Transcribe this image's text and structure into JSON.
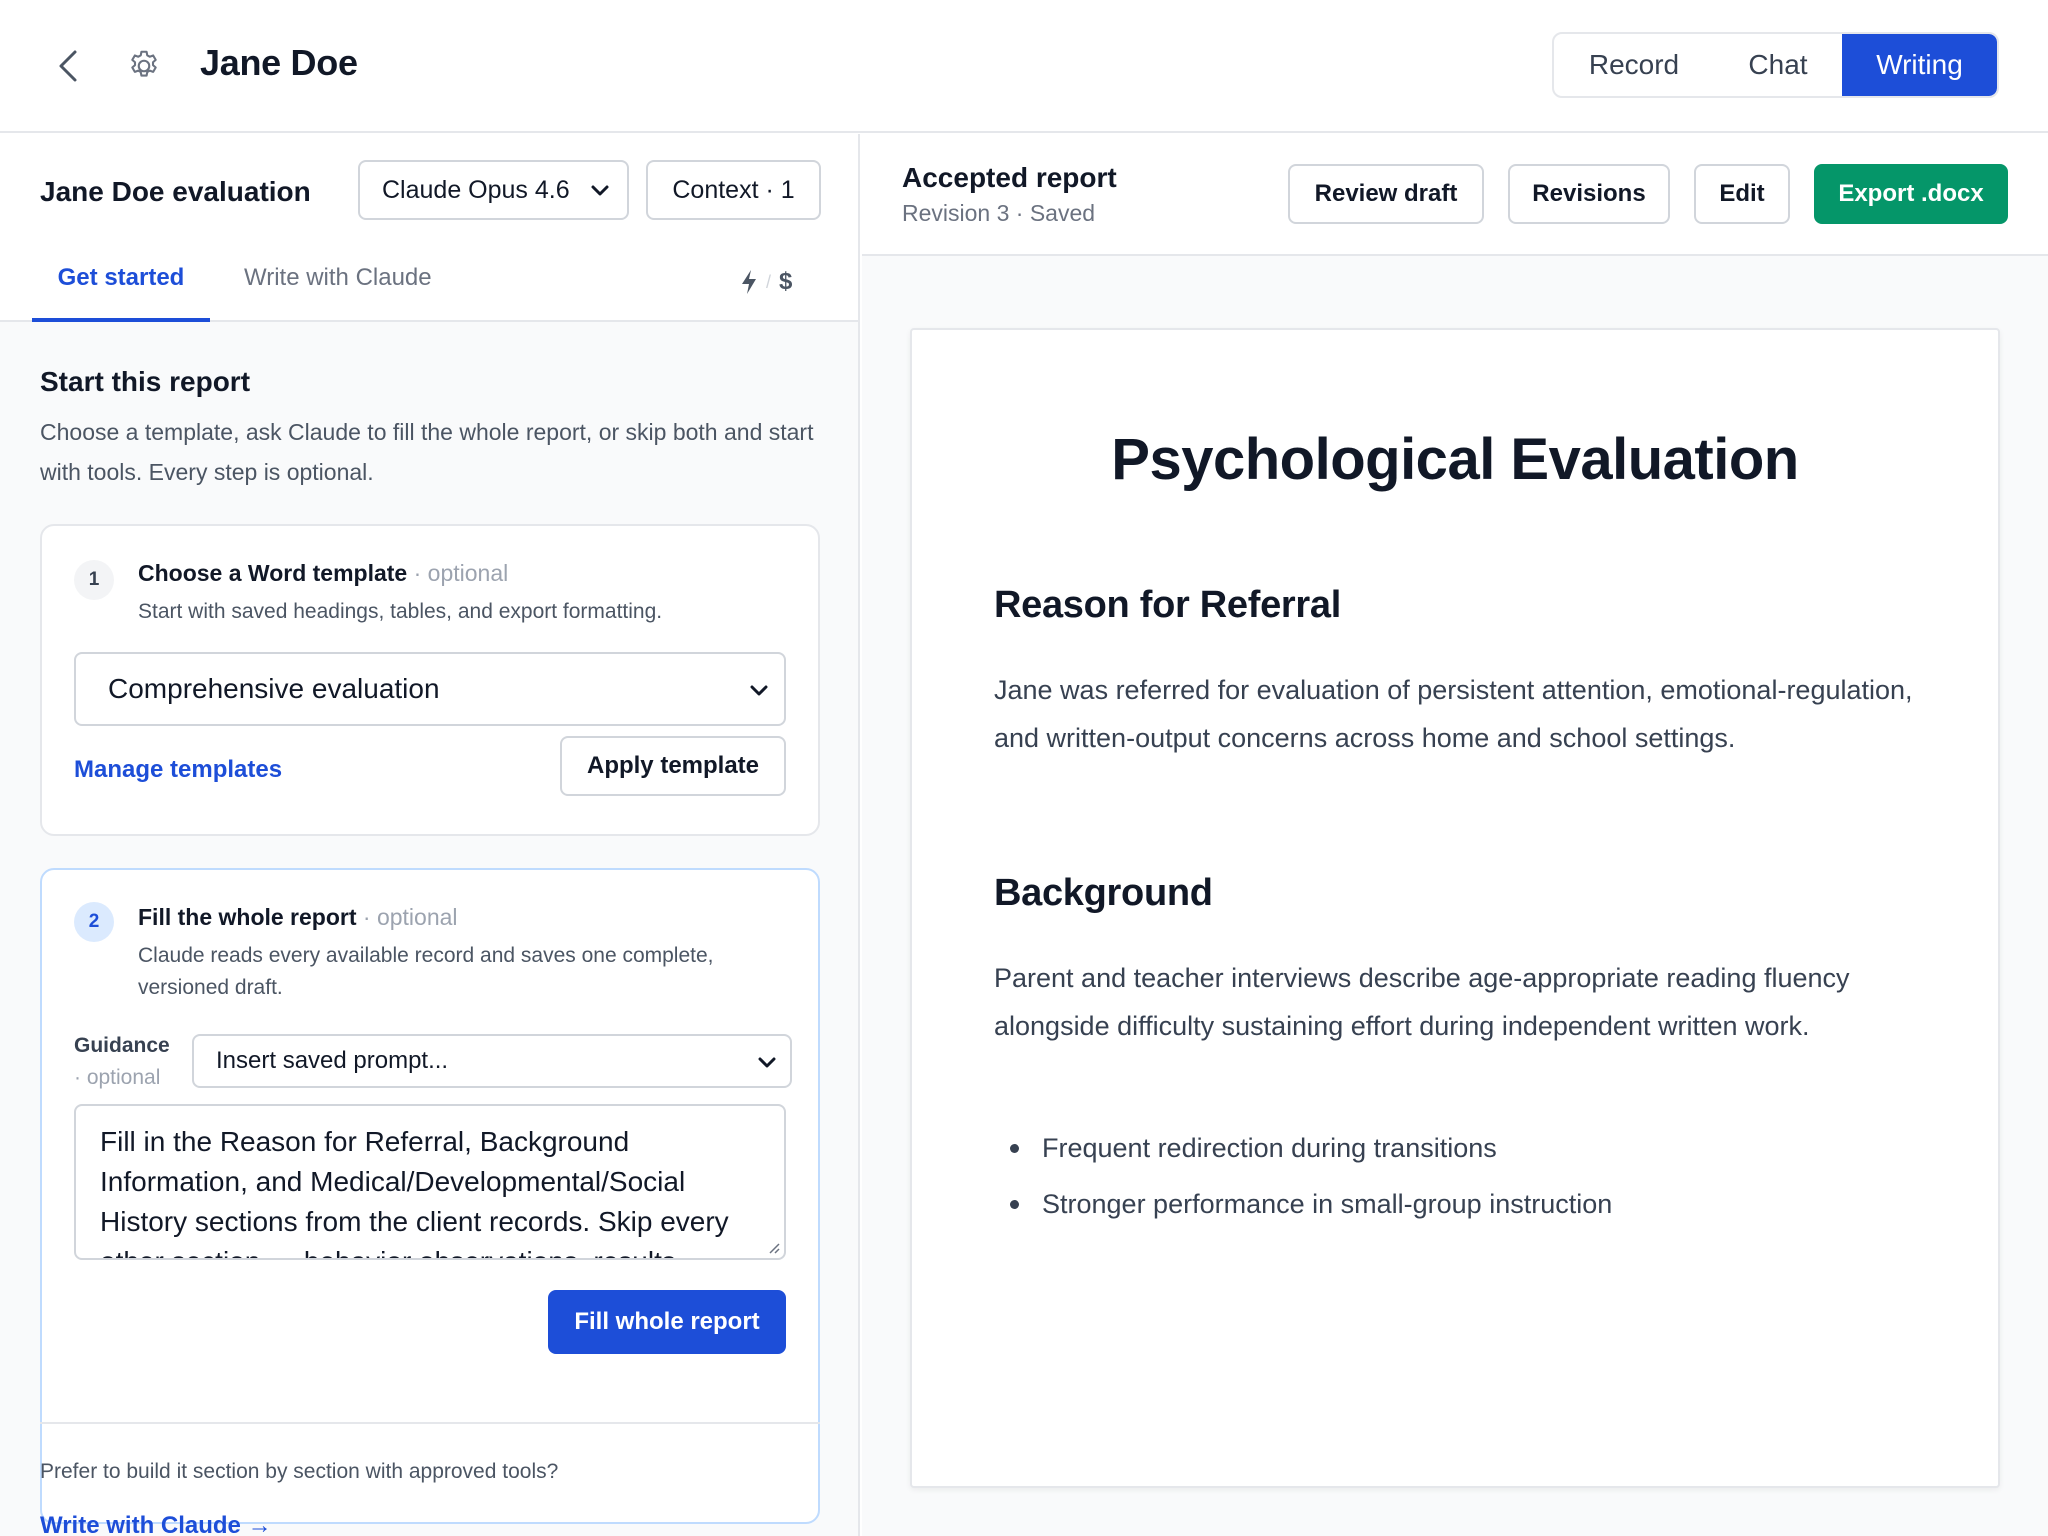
{
  "header": {
    "title": "Jane Doe",
    "modes": [
      "Record",
      "Chat",
      "Writing"
    ],
    "active_mode": "Writing"
  },
  "left": {
    "report_name": "Jane Doe evaluation",
    "model": "Claude Opus 4.6",
    "context_label": "Context · 1",
    "tabs": [
      "Get started",
      "Write with Claude"
    ],
    "mode_icons": {
      "fast": "lightning-icon",
      "sep": "/",
      "cost": "$"
    },
    "start_title": "Start this report",
    "start_desc": "Choose a template, ask Claude to fill the whole report, or skip both and start with tools. Every step is optional.",
    "step1": {
      "number": "1",
      "title": "Choose a Word template",
      "optional": " · optional",
      "desc": "Start with saved headings, tables, and export formatting.",
      "selected_template": "Comprehensive evaluation",
      "manage_link": "Manage templates",
      "apply_label": "Apply template"
    },
    "step2": {
      "number": "2",
      "title": "Fill the whole report",
      "optional": " · optional",
      "desc": "Claude reads every available record and saves one complete, versioned draft.",
      "guidance_label": "Guidance",
      "guidance_optional": "· optional",
      "prompt_select": "Insert saved prompt...",
      "guidance_text": "Fill in the Reason for Referral, Background Information, and Medical/Developmental/Social History sections from the client records. Skip every other section — behavior observations, results",
      "fill_label": "Fill whole report"
    },
    "prefer_text": "Prefer to build it section by section with approved tools?",
    "write_link": "Write with Claude →"
  },
  "right": {
    "accepted_title": "Accepted report",
    "revision_status": "Revision 3 · Saved",
    "buttons": {
      "review": "Review draft",
      "revisions": "Revisions",
      "edit": "Edit",
      "export": "Export .docx"
    },
    "doc": {
      "title": "Psychological Evaluation",
      "reason_heading": "Reason for Referral",
      "reason_text": "Jane was referred for evaluation of persistent attention, emotional-regulation, and written-output concerns across home and school settings.",
      "background_heading": "Background",
      "background_text": "Parent and teacher interviews describe age-appropriate reading fluency alongside difficulty sustaining effort during independent written work.",
      "bullets": [
        "Frequent redirection during transitions",
        "Stronger performance in small-group instruction"
      ]
    }
  },
  "colors": {
    "accent": "#1d4ed8",
    "export": "#059669",
    "border": "#e5e7eb",
    "muted_text": "#6b7280"
  }
}
